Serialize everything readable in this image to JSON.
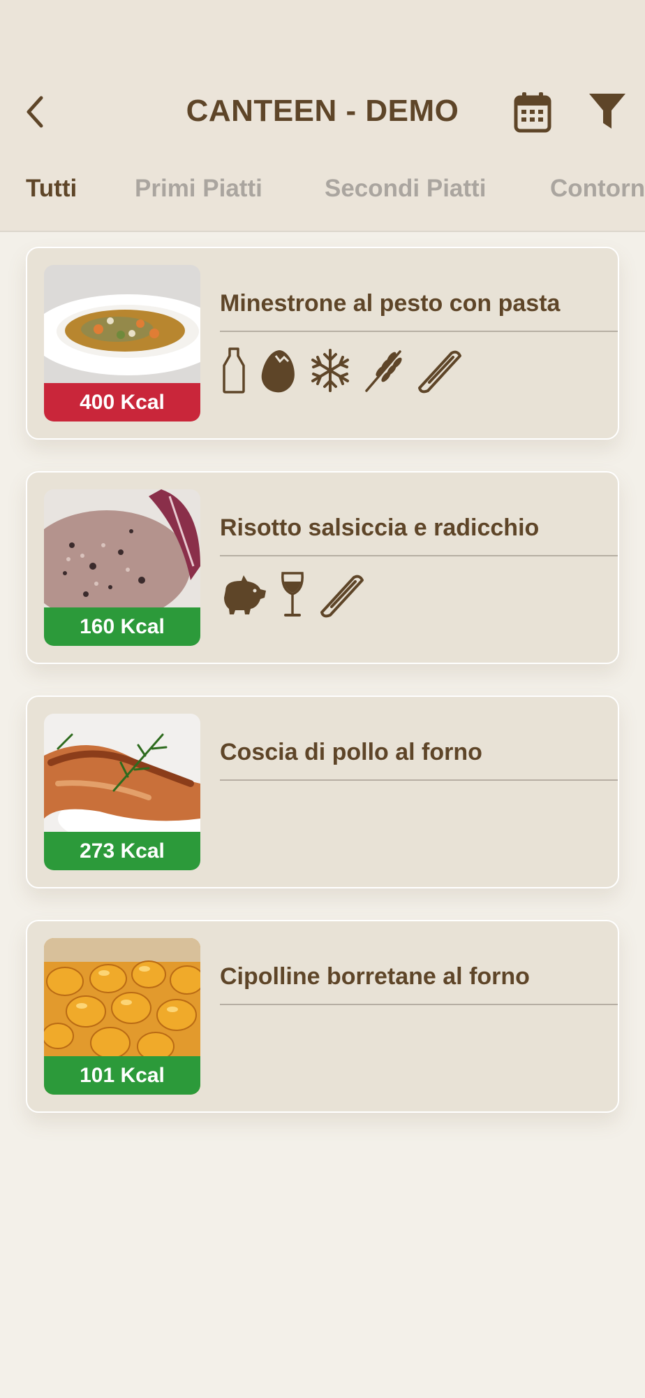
{
  "header": {
    "title": "CANTEEN - DEMO",
    "back_icon": "chevron-left-icon",
    "calendar_icon": "calendar-icon",
    "filter_icon": "filter-icon"
  },
  "tabs": [
    {
      "label": "Tutti",
      "active": true
    },
    {
      "label": "Primi Piatti",
      "active": false
    },
    {
      "label": "Secondi Piatti",
      "active": false
    },
    {
      "label": "Contorni",
      "active": false
    }
  ],
  "dishes": [
    {
      "name": "Minestrone al pesto con pasta",
      "kcal": "400 Kcal",
      "kcal_color": "#c9263a",
      "allergens": [
        "milk-icon",
        "egg-icon",
        "frozen-icon",
        "wheat-icon",
        "celery-icon"
      ]
    },
    {
      "name": "Risotto salsiccia e radicchio",
      "kcal": "160 Kcal",
      "kcal_color": "#2c9a3a",
      "allergens": [
        "pork-icon",
        "wine-icon",
        "celery-icon"
      ]
    },
    {
      "name": "Coscia di pollo al forno",
      "kcal": "273 Kcal",
      "kcal_color": "#2c9a3a",
      "allergens": []
    },
    {
      "name": "Cipolline borretane al forno",
      "kcal": "101 Kcal",
      "kcal_color": "#2c9a3a",
      "allergens": []
    }
  ],
  "colors": {
    "primary_text": "#5e4528",
    "inactive_tab": "#aaa59f",
    "header_bg": "#ebe4d9",
    "card_bg": "#e8e2d6"
  }
}
